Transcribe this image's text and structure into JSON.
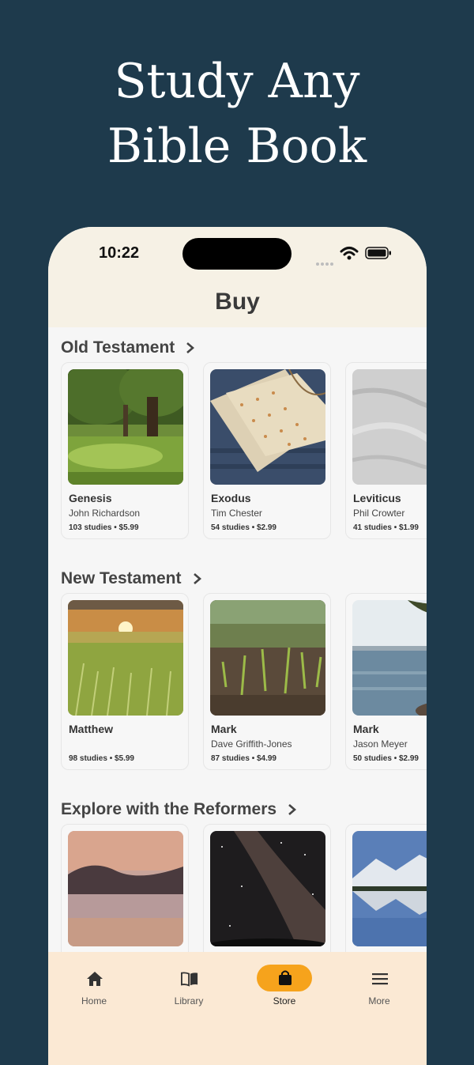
{
  "hero": {
    "line1": "Study Any",
    "line2": "Bible Book"
  },
  "status_bar": {
    "time": "10:22"
  },
  "page_title": "Buy",
  "colors": {
    "background": "#1e3a4c",
    "header": "#f6f1e5",
    "tabbar": "#fbe9d4",
    "accent": "#f6a31c"
  },
  "sections": [
    {
      "title": "Old Testament",
      "cards": [
        {
          "title": "Genesis",
          "author": "John Richardson",
          "meta": "103 studies • $5.99",
          "image": "forest-park-photo"
        },
        {
          "title": "Exodus",
          "author": "Tim Chester",
          "meta": "54 studies • $2.99",
          "image": "matzah-bread-photo"
        },
        {
          "title": "Leviticus",
          "author": "Phil Crowter",
          "meta": "41 studies • $1.99",
          "image": "linen-cloth-photo"
        }
      ]
    },
    {
      "title": "New Testament",
      "cards": [
        {
          "title": "Matthew",
          "author": "",
          "meta": "98 studies • $5.99",
          "image": "wheat-field-sunset-photo"
        },
        {
          "title": "Mark",
          "author": "Dave Griffith-Jones",
          "meta": "87 studies • $4.99",
          "image": "seedlings-photo"
        },
        {
          "title": "Mark",
          "author": "Jason Meyer",
          "meta": "50 studies • $2.99",
          "image": "lake-shore-photo"
        }
      ]
    },
    {
      "title": "Explore with the Reformers",
      "cards": [
        {
          "title": "",
          "author": "",
          "meta": "",
          "image": "misty-lake-dawn-photo"
        },
        {
          "title": "",
          "author": "",
          "meta": "",
          "image": "milky-way-photo"
        },
        {
          "title": "",
          "author": "",
          "meta": "",
          "image": "mountain-lake-photo"
        }
      ]
    }
  ],
  "tabs": [
    {
      "label": "Home",
      "icon": "home-icon"
    },
    {
      "label": "Library",
      "icon": "book-icon"
    },
    {
      "label": "Store",
      "icon": "shopping-bag-icon",
      "active": true
    },
    {
      "label": "More",
      "icon": "menu-icon"
    }
  ]
}
